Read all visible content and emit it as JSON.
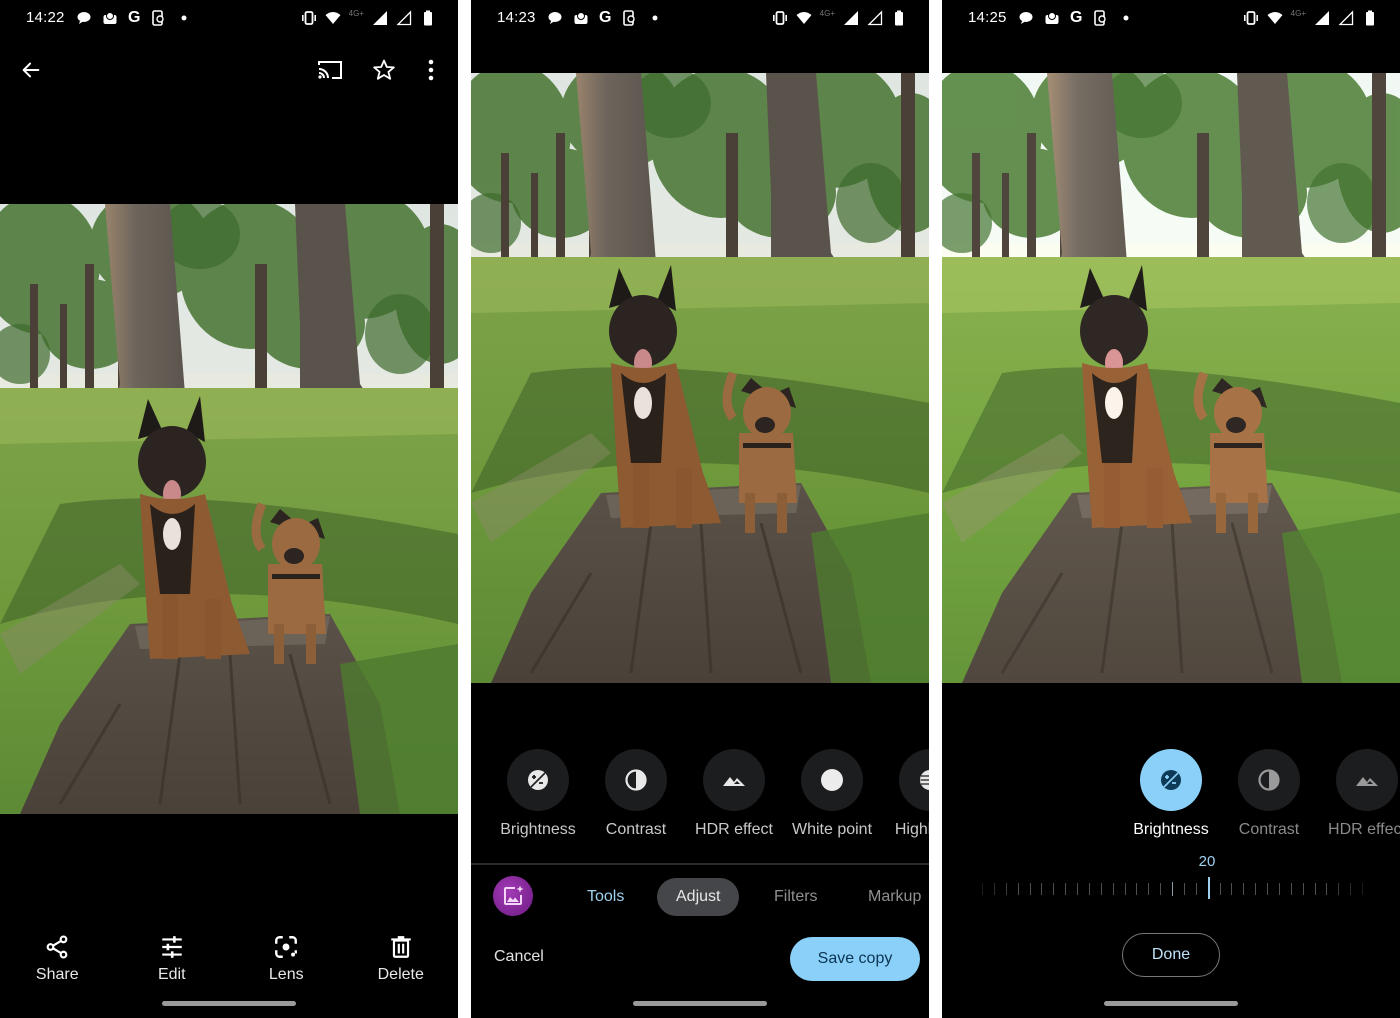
{
  "panels": [
    {
      "status": {
        "time": "14:22",
        "network": "4G+"
      },
      "topbar": {
        "back": "back-icon",
        "cast": "cast-icon",
        "favorite": "star-icon",
        "more": "more-vert-icon"
      },
      "photo": {
        "description": "Two dogs sitting on a tree stump in a park with trees"
      },
      "actions": [
        {
          "label": "Share",
          "icon": "share-icon"
        },
        {
          "label": "Edit",
          "icon": "tune-icon"
        },
        {
          "label": "Lens",
          "icon": "lens-icon"
        },
        {
          "label": "Delete",
          "icon": "trash-icon"
        }
      ]
    },
    {
      "status": {
        "time": "14:23",
        "network": "4G+"
      },
      "tools": [
        {
          "label": "Brightness",
          "icon": "brightness-icon"
        },
        {
          "label": "Contrast",
          "icon": "contrast-icon"
        },
        {
          "label": "HDR effect",
          "icon": "hdr-icon"
        },
        {
          "label": "White point",
          "icon": "white-point-icon"
        },
        {
          "label": "Highlights",
          "icon": "highlights-icon"
        }
      ],
      "tabs": [
        {
          "label": "Tools",
          "state": "default"
        },
        {
          "label": "Adjust",
          "state": "selected"
        },
        {
          "label": "Filters",
          "state": "default"
        },
        {
          "label": "Markup",
          "state": "default"
        }
      ],
      "magic_button": "magic-editor-icon",
      "cancel_label": "Cancel",
      "save_label": "Save copy"
    },
    {
      "status": {
        "time": "14:25",
        "network": "4G+"
      },
      "tools": [
        {
          "label": "Brightness",
          "icon": "brightness-icon",
          "active": true
        },
        {
          "label": "Contrast",
          "icon": "contrast-icon"
        },
        {
          "label": "HDR effect",
          "icon": "hdr-icon"
        }
      ],
      "slider": {
        "label": "Brightness",
        "value": "20",
        "min": -100,
        "max": 100
      },
      "done_label": "Done"
    }
  ],
  "colors": {
    "accent": "#8ad0f8",
    "accent_text": "#9fd0f0",
    "background": "#000000",
    "tab_selected_bg": "#444649",
    "magic_purple": "#8e2aa3"
  }
}
